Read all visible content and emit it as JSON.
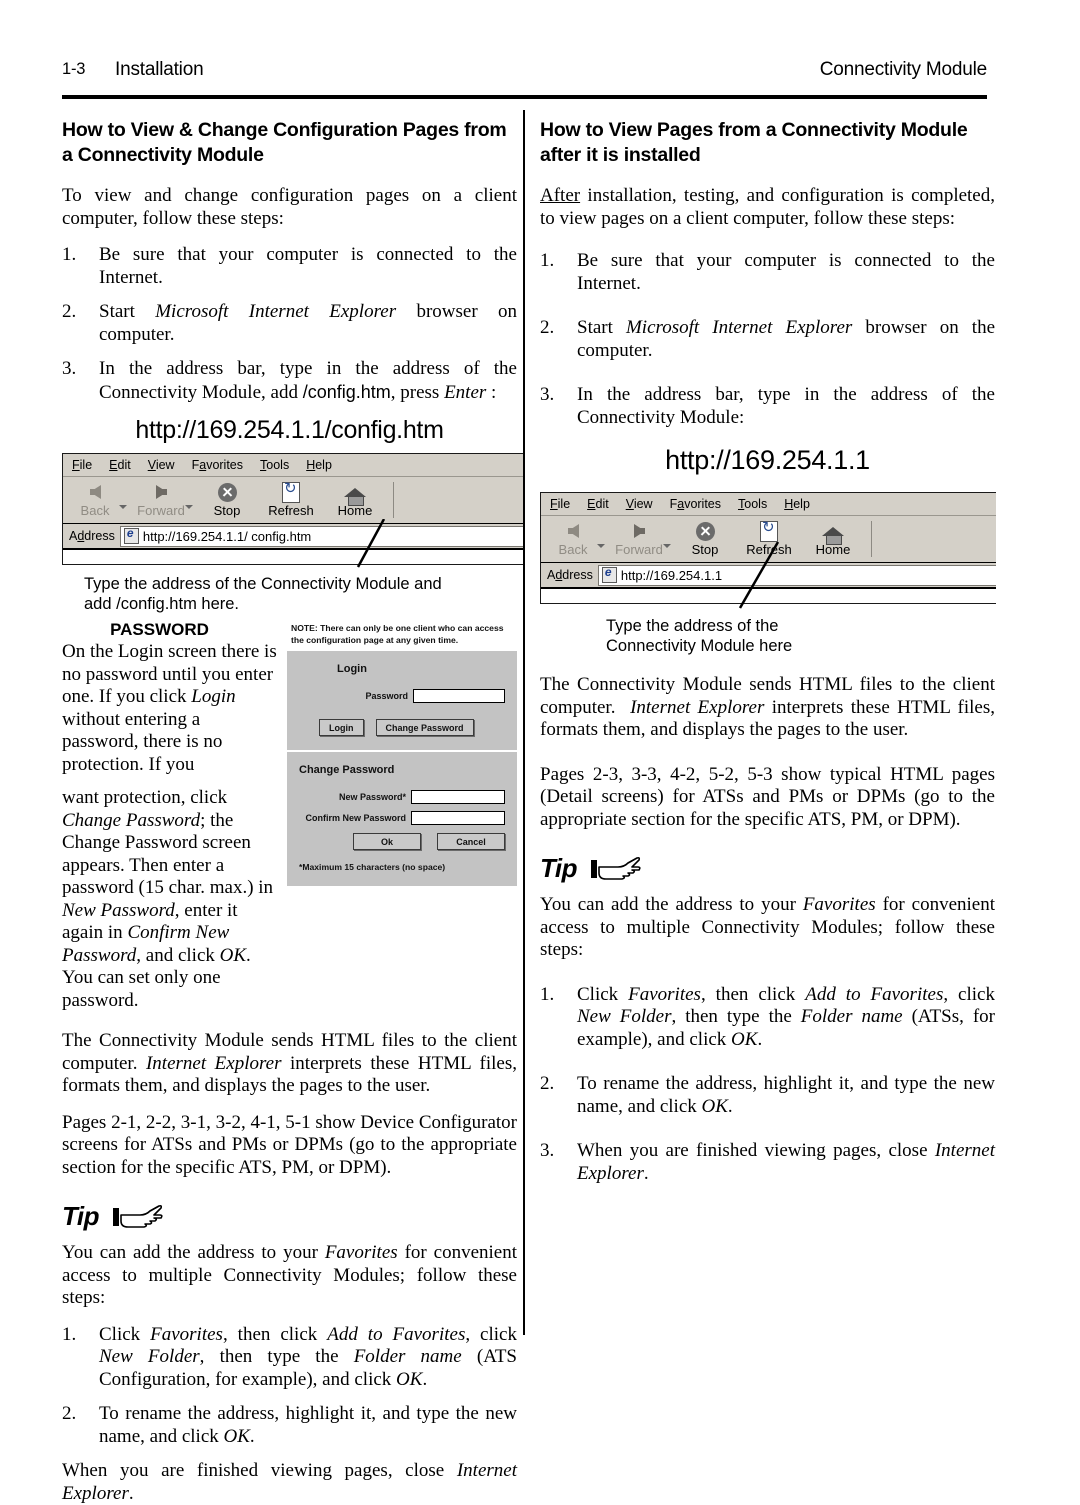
{
  "header": {
    "page_number": "1-3",
    "section": "Installation",
    "product": "Connectivity Module"
  },
  "left_column": {
    "title": "How to View & Change Configuration Pages from a Connectivity Module",
    "intro": "To view and change configuration pages on a client computer, follow these steps:",
    "steps": [
      {
        "num": "1.",
        "text": "Be sure that your computer is connected to the Internet."
      },
      {
        "num": "2.",
        "text": "Start Microsoft Internet Explorer browser on computer."
      },
      {
        "num": "3.",
        "text": "In the address bar, type in the address of the Connectivity Module, add /config.htm, press Enter :"
      }
    ],
    "url_caption": "http://169.254.1.1/config.htm",
    "browser": {
      "menu": [
        "File",
        "Edit",
        "View",
        "Favorites",
        "Tools",
        "Help"
      ],
      "buttons": [
        "Back",
        "Forward",
        "Stop",
        "Refresh",
        "Home"
      ],
      "address_label": "Address",
      "address_value": "http://169.254.1.1/ config.htm"
    },
    "callout": "Type the address of the Connectivity Module and add /config.htm  here.",
    "password_heading": "PASSWORD",
    "password_text_1": "On the Login screen there is no password until you enter one. If you click Login without entering a password, there is no protection. If you",
    "password_text_2": "want protection, click Change Password; the Change Password screen appears. Then enter a password (15 char. max.) in New Password, enter it again in Confirm New Password, and click OK.  You can set only one password.",
    "login_shot": {
      "note": "NOTE: There can only be one client who can access the configuration page at any given time.",
      "login_heading": "Login",
      "password_label": "Password",
      "login_button": "Login",
      "change_password_button": "Change Password",
      "change_heading": "Change Password",
      "new_password_label": "New Password*",
      "confirm_password_label": "Confirm New Password",
      "ok_button": "Ok",
      "cancel_button": "Cancel",
      "footnote": "*Maximum 15 characters (no space)"
    },
    "para_sends": "The Connectivity Module sends HTML files to the client computer. Internet Explorer interprets these HTML files, formats them, and displays the pages to the user.",
    "para_pages": "Pages 2-1, 2-2, 3-1, 3-2, 4-1, 5-1 show Device Configurator screens for ATSs and PMs or DPMs (go to the appropriate section for the specific ATS, PM, or DPM).",
    "tip_word": "Tip",
    "tip_intro": "You can add the address to your Favorites for convenient access to multiple Connectivity Modules; follow these steps:",
    "tip_steps": [
      {
        "num": "1.",
        "text": "Click Favorites, then click Add to Favorites, click New Folder, then type the Folder name (ATS Configuration, for example), and click OK."
      },
      {
        "num": "2.",
        "text": "To rename the address, highlight it, and type the new name, and click OK."
      }
    ],
    "closing": "When you are finished viewing pages, close Internet Explorer."
  },
  "right_column": {
    "title": "How to View Pages from a Connectivity Module after it is installed",
    "intro": "After installation, testing, and configuration is completed, to view pages on a client computer, follow these steps:",
    "steps": [
      {
        "num": "1.",
        "text": "Be sure that your computer is connected to the Internet."
      },
      {
        "num": "2.",
        "text": "Start Microsoft Internet Explorer browser on the computer."
      },
      {
        "num": "3.",
        "text": "In the address bar, type in the address of the Connectivity Module:"
      }
    ],
    "url_caption": "http://169.254.1.1",
    "browser": {
      "menu": [
        "File",
        "Edit",
        "View",
        "Favorites",
        "Tools",
        "Help"
      ],
      "buttons": [
        "Back",
        "Forward",
        "Stop",
        "Refresh",
        "Home"
      ],
      "address_label": "Address",
      "address_value": "http://169.254.1.1"
    },
    "callout": "Type the address of the Connectivity Module here",
    "para_sends": "The Connectivity Module sends HTML files to the client computer.  Internet Explorer interprets these HTML files, formats them, and displays the pages to the user.",
    "para_pages": "Pages 2-3, 3-3, 4-2, 5-2, 5-3 show typical HTML pages (Detail screens) for ATSs and PMs or DPMs (go to the appropriate section for the specific ATS, PM, or DPM).",
    "tip_word": "Tip",
    "tip_intro": "You can add the address to your Favorites for convenient access to multiple Connectivity Modules; follow these steps:",
    "tip_steps": [
      {
        "num": "1.",
        "text": "Click Favorites, then click Add to Favorites, click New Folder, then type the Folder name (ATSs, for example), and click OK."
      },
      {
        "num": "2.",
        "text": "To rename the address, highlight it, and type the new name, and click OK."
      },
      {
        "num": "3.",
        "text": "When you are finished viewing pages, close Internet Explorer."
      }
    ]
  }
}
